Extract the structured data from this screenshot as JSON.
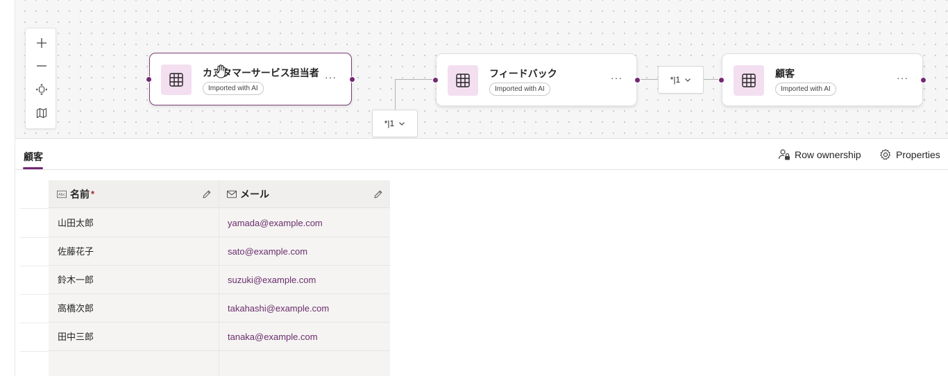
{
  "canvas": {
    "zoom_toolbar": {
      "zoom_in_icon": "plus-icon",
      "zoom_out_icon": "minus-icon",
      "fit_icon": "fit-view-icon",
      "map_icon": "map-icon"
    },
    "nodes": [
      {
        "title": "カスタマーサービス担当者",
        "badge": "Imported with AI",
        "more": "···",
        "selected": true
      },
      {
        "title": "フィードバック",
        "badge": "Imported with AI",
        "more": "···",
        "selected": false
      },
      {
        "title": "顧客",
        "badge": "Imported with AI",
        "more": "···",
        "selected": false
      }
    ],
    "relationships": [
      {
        "label": "*|1"
      },
      {
        "label": "*|1"
      }
    ],
    "accent_color": "#742774",
    "node_icon_bg": "#f3dff0"
  },
  "detail": {
    "tab": "顧客",
    "actions": {
      "row_ownership": "Row ownership",
      "properties": "Properties"
    }
  },
  "grid": {
    "columns": [
      {
        "label": "名前",
        "required_mark": "*",
        "type_icon": "text-abc-icon"
      },
      {
        "label": "メール",
        "type_icon": "mail-icon"
      }
    ],
    "rows": [
      {
        "name": "山田太郎",
        "email": "yamada@example.com"
      },
      {
        "name": "佐藤花子",
        "email": "sato@example.com"
      },
      {
        "name": "鈴木一郎",
        "email": "suzuki@example.com"
      },
      {
        "name": "高橋次郎",
        "email": "takahashi@example.com"
      },
      {
        "name": "田中三郎",
        "email": "tanaka@example.com"
      }
    ]
  }
}
